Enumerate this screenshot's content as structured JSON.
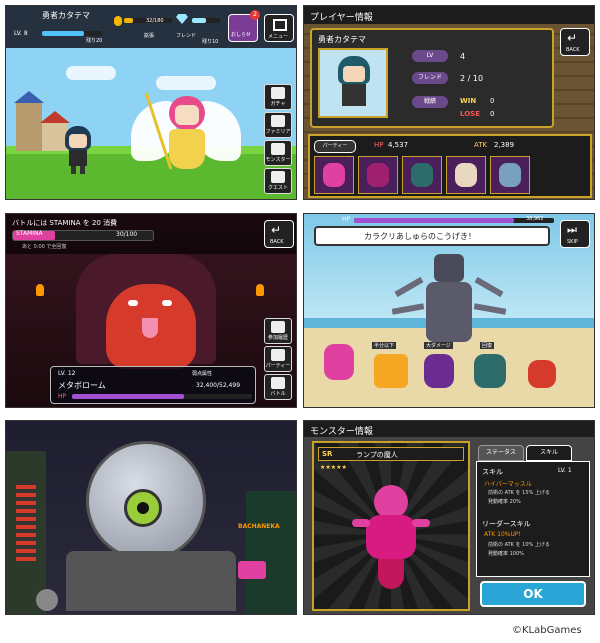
{
  "p1": {
    "player_name": "勇者カタテマ",
    "lv": "LV. 8",
    "exp_label": "残り20",
    "coin": "32/180",
    "gem_label": "拡張",
    "notice_label": "おしらせ",
    "notice_count": "2",
    "misc1": "フレンド",
    "misc2": "残り10",
    "menu_label": "メニュー",
    "side_buttons": [
      "ガチャ",
      "ファミリア",
      "モンスター",
      "クエスト"
    ]
  },
  "p2": {
    "header": "プレイヤー情報",
    "back": "BACK",
    "player_name": "勇者カタテマ",
    "lv_label": "LV",
    "lv_value": "4",
    "friend_label": "フレンド",
    "friend_value": "2 / 10",
    "record_label": "戦績",
    "win_label": "WIN",
    "win_value": "0",
    "lose_label": "LOSE",
    "lose_value": "0",
    "party_label": "パーティー",
    "hp_label": "HP",
    "hp_value": "4,537",
    "atk_label": "ATK",
    "atk_value": "2,389"
  },
  "p3": {
    "battle_text": "バトルには STAMINA を 20 消費",
    "stamina_label": "STAMINA",
    "stamina_value": "30/100",
    "recover_text": "あと 0:00 で全回復",
    "back": "BACK",
    "side_buttons": [
      "参加履歴",
      "パーティー",
      "バトル"
    ],
    "monster_lv": "LV. 12",
    "monster_name": "メタボローム",
    "attr_label": "弱点属性",
    "hp_label": "HP",
    "hp_value": "32,400/52,499"
  },
  "p4": {
    "hp_label": "HP",
    "hp_value": "38,962",
    "dialog": "カラクリあしゅらのこうげき！",
    "skip": "SKIP",
    "small_labels": [
      "半分以下",
      "大ダメージ",
      "回復"
    ]
  },
  "p5": {
    "sign_text": "BACHANEKA"
  },
  "p6": {
    "header": "モンスター情報",
    "rarity": "SR",
    "monster_name": "ランプの魔人",
    "stars": "★★★★★",
    "tab_status": "ステータス",
    "tab_skill": "スキル",
    "skill_label": "スキル",
    "skill_lv": "LV. 1",
    "skill_name": "ハイパーマッスル",
    "skill_desc1": "前衛の ATK を 15% 上げる",
    "skill_desc2": "発動確率 20%",
    "leader_label": "リーダースキル",
    "leader_name": "ATK 10%UP!",
    "leader_desc1": "前衛の ATK を 10% 上げる",
    "leader_desc2": "発動確率 100%",
    "ok": "OK"
  },
  "copyright": "©KLabGames",
  "colors": {
    "sky": "#8fd3f4",
    "grass": "#5cb82e",
    "panel_dark": "#2b2b2b",
    "gold": "#c9a227",
    "red_demon": "#d63a2a",
    "purple": "#6a2c91",
    "ok_button": "#2aa6d6"
  }
}
